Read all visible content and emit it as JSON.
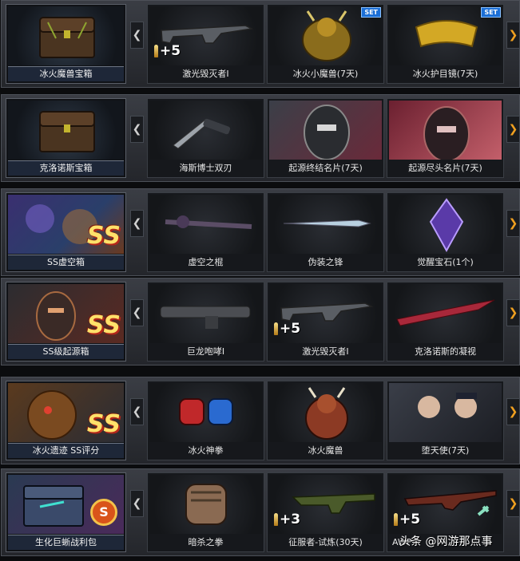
{
  "rows": [
    {
      "box": "冰火魔兽宝箱",
      "items": [
        {
          "label": "激光毁灭者Ⅰ",
          "qty": "+5",
          "set": ""
        },
        {
          "label": "冰火小魔兽(7天)",
          "qty": "",
          "set": "SET"
        },
        {
          "label": "冰火护目镜(7天)",
          "qty": "",
          "set": "SET"
        }
      ]
    },
    {
      "box": "克洛诺斯宝箱",
      "items": [
        {
          "label": "海斯博士双刃",
          "qty": "",
          "set": ""
        },
        {
          "label": "起源终结名片(7天)",
          "qty": "",
          "set": ""
        },
        {
          "label": "起源尽头名片(7天)",
          "qty": "",
          "set": ""
        }
      ]
    },
    {
      "box": "SS虚空箱",
      "badge": "SS",
      "items": [
        {
          "label": "虚空之棍",
          "qty": "",
          "set": ""
        },
        {
          "label": "伪装之锋",
          "qty": "",
          "set": ""
        },
        {
          "label": "觉醒宝石(1个)",
          "qty": "",
          "set": ""
        }
      ]
    },
    {
      "box": "SS级起源箱",
      "badge": "SS",
      "items": [
        {
          "label": "巨龙咆哮Ⅰ",
          "qty": "",
          "set": ""
        },
        {
          "label": "激光毁灭者Ⅰ",
          "qty": "+5",
          "set": ""
        },
        {
          "label": "克洛诺斯的凝视",
          "qty": "",
          "set": ""
        }
      ]
    },
    {
      "box": "冰火遗迹 SS评分",
      "badge": "SS",
      "items": [
        {
          "label": "冰火神拳",
          "qty": "",
          "set": ""
        },
        {
          "label": "冰火魔兽",
          "qty": "",
          "set": ""
        },
        {
          "label": "堕天使(7天)",
          "qty": "",
          "set": ""
        }
      ]
    },
    {
      "box": "生化巨蜥战利包",
      "badge": "S",
      "items": [
        {
          "label": "暗杀之拳",
          "qty": "",
          "set": ""
        },
        {
          "label": "征服者-试炼(30天)",
          "qty": "+3",
          "set": ""
        },
        {
          "label": "AWP",
          "qty": "+5",
          "set": ""
        }
      ]
    }
  ],
  "nav": {
    "left": "❮",
    "right": "❯"
  },
  "watermark": "头条 @网游那点事",
  "colors": {
    "accent": "#f0a020",
    "set_badge": "#1c6fd6",
    "ss_badge": "#ffe16a"
  }
}
